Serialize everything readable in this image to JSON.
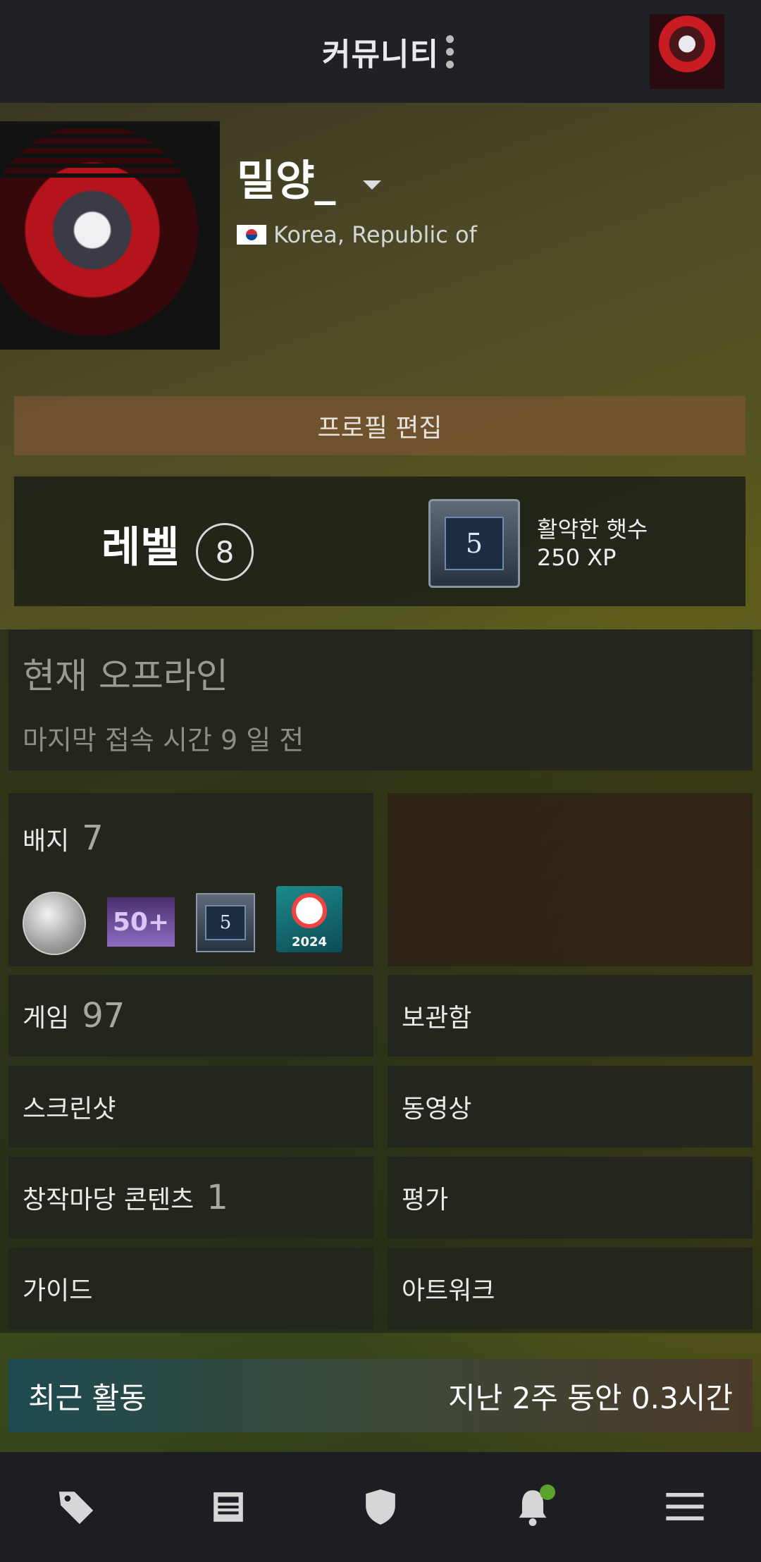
{
  "header": {
    "title": "커뮤니티"
  },
  "profile": {
    "username": "밀양_",
    "country": "Korea, Republic of",
    "edit_button": "프로필 편집"
  },
  "level": {
    "label": "레벨",
    "value": "8",
    "badge_icon_number": "5",
    "badge_name": "활약한 햇수",
    "badge_xp": "250 XP"
  },
  "status": {
    "title": "현재 오프라인",
    "last_online": "마지막 접속 시간 9 일 전"
  },
  "sections": {
    "badges": {
      "label": "배지",
      "count": "7",
      "badge_5": "5",
      "badge_50": "50+",
      "badge_2024": "2024"
    },
    "games": {
      "label": "게임",
      "count": "97"
    },
    "inventory": {
      "label": "보관함"
    },
    "screenshots": {
      "label": "스크린샷"
    },
    "videos": {
      "label": "동영상"
    },
    "workshop": {
      "label": "창작마당 콘텐츠",
      "count": "1"
    },
    "reviews": {
      "label": "평가"
    },
    "guides": {
      "label": "가이드"
    },
    "artwork": {
      "label": "아트워크"
    }
  },
  "recent_activity": {
    "title": "최근 활동",
    "time": "지난 2주 동안 0.3시간"
  },
  "bottom_nav": {
    "items": [
      "tag-icon",
      "news-icon",
      "shield-icon",
      "bell-icon",
      "menu-icon"
    ]
  }
}
